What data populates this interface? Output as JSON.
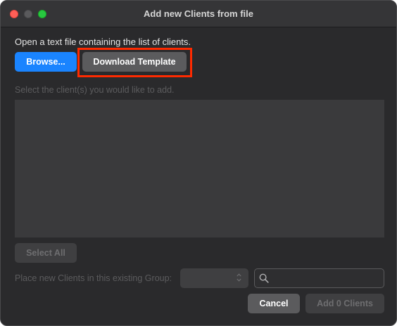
{
  "window": {
    "title": "Add new Clients from file"
  },
  "instruction": "Open a text file containing the list of clients.",
  "buttons": {
    "browse": "Browse...",
    "download_template": "Download Template",
    "select_all": "Select All",
    "cancel": "Cancel",
    "add_clients": "Add 0 Clients"
  },
  "select_label": "Select the client(s) you would like to add.",
  "clients": [],
  "group": {
    "label": "Place new Clients in this existing Group:",
    "selected": ""
  },
  "search": {
    "value": "",
    "placeholder": ""
  },
  "icons": {
    "search": "search-icon",
    "stepper": "up-down-chevron-icon"
  },
  "colors": {
    "accent": "#1a84ff",
    "highlight": "#ff2a00",
    "close": "#ff5f57",
    "maximize": "#28c840"
  }
}
